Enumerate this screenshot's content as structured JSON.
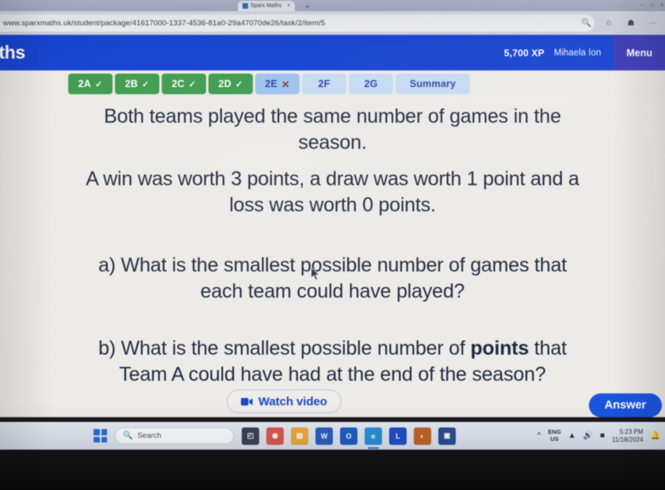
{
  "browser": {
    "tab_title": "Sparx Maths",
    "url": "www.sparxmaths.uk/student/package/41617000-1337-4536-81a0-29a47070de26/task/2/item/5",
    "zoom_icon": "search-icon",
    "favourite_icon": "star-icon",
    "collections_icon": "collections-icon",
    "more_icon": "ellipsis-icon",
    "new_tab_label": "+",
    "tab_close_label": "×",
    "window_minimize": "–",
    "window_maximize": "□",
    "window_close": "×"
  },
  "app_header": {
    "logo_text": "aths",
    "xp": "5,700 XP",
    "user": "Mihaela Ion",
    "menu_label": "Menu",
    "brand_color": "#1542cf",
    "menu_color": "#3b3bb8"
  },
  "task_tabs": [
    {
      "label": "2A",
      "state": "done",
      "marker": "✓"
    },
    {
      "label": "2B",
      "state": "done",
      "marker": "✓"
    },
    {
      "label": "2C",
      "state": "done",
      "marker": "✓"
    },
    {
      "label": "2D",
      "state": "done",
      "marker": "✓"
    },
    {
      "label": "2E",
      "state": "current",
      "marker": "✕"
    },
    {
      "label": "2F",
      "state": "todo",
      "marker": ""
    },
    {
      "label": "2G",
      "state": "todo",
      "marker": ""
    },
    {
      "label": "Summary",
      "state": "summary",
      "marker": ""
    }
  ],
  "question": {
    "stem_line1": "Both teams played the same number of games in the",
    "stem_line2": "season.",
    "stem_line3": "A win was worth 3 points, a draw was worth 1 point and a",
    "stem_line4": "loss was worth 0 points.",
    "part_a_line1": "a) What is the smallest possible number of games that",
    "part_a_line2": "each team could have played?",
    "part_b_pre": "b) What is the smallest possible number of ",
    "part_b_bold": "points",
    "part_b_post": " that",
    "part_b_line2": "Team A could have had at the end of the season?"
  },
  "actions": {
    "watch_video_label": "Watch video",
    "watch_video_icon": "video-camera-icon",
    "answer_label": "Answer",
    "answer_color": "#1b55e0"
  },
  "taskbar": {
    "start_icon": "windows-start-icon",
    "search_placeholder": "Search",
    "search_icon": "search-icon",
    "apps": [
      {
        "name": "task-view-icon",
        "glyph": "◰",
        "color": "#3b4252"
      },
      {
        "name": "copilot-icon",
        "glyph": "◉",
        "color": "#d9584e"
      },
      {
        "name": "file-explorer-icon",
        "glyph": "▤",
        "color": "#e8a83a"
      },
      {
        "name": "office-icon",
        "glyph": "W",
        "color": "#2b5fb8"
      },
      {
        "name": "outlook-icon",
        "glyph": "O",
        "color": "#1f5fbf"
      },
      {
        "name": "edge-icon",
        "glyph": "e",
        "color": "#2a8fd6"
      },
      {
        "name": "linkedin-app-icon",
        "glyph": "L",
        "color": "#1f4fc4"
      },
      {
        "name": "photos-app-icon",
        "glyph": "◐",
        "color": "#c0632c"
      },
      {
        "name": "store-app-icon",
        "glyph": "▣",
        "color": "#2b4d8f"
      }
    ],
    "tray": {
      "overflow_icon": "chevron-up-icon",
      "language_line1": "ENG",
      "language_line2": "US",
      "wifi_icon": "wifi-icon",
      "volume_icon": "speaker-icon",
      "battery_icon": "battery-icon",
      "time": "5:23 PM",
      "date": "11/18/2024",
      "notification_icon": "bell-icon"
    }
  }
}
